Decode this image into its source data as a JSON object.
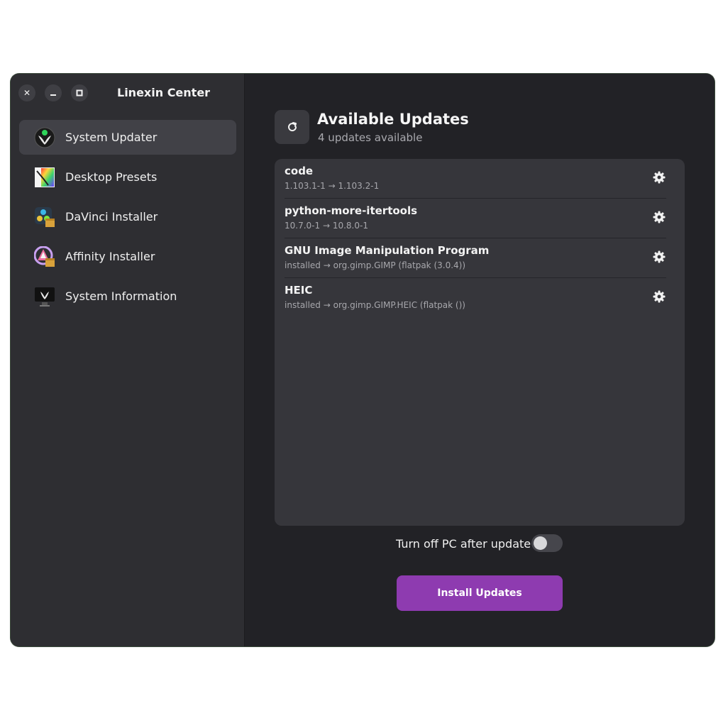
{
  "window": {
    "title": "Linexin Center",
    "controls": {
      "close": "✕",
      "minimize": "–",
      "maximize": "□"
    }
  },
  "sidebar": {
    "items": [
      {
        "label": "System Updater",
        "icon": "system-updater-icon",
        "active": true
      },
      {
        "label": "Desktop Presets",
        "icon": "desktop-presets-icon",
        "active": false
      },
      {
        "label": "DaVinci Installer",
        "icon": "davinci-installer-icon",
        "active": false
      },
      {
        "label": "Affinity Installer",
        "icon": "affinity-installer-icon",
        "active": false
      },
      {
        "label": "System Information",
        "icon": "system-information-icon",
        "active": false
      }
    ]
  },
  "main": {
    "title": "Available Updates",
    "subtitle": "4 updates available",
    "updates": [
      {
        "name": "code",
        "version": "1.103.1-1 → 1.103.2-1"
      },
      {
        "name": "python-more-itertools",
        "version": "10.7.0-1 → 10.8.0-1"
      },
      {
        "name": "GNU Image Manipulation Program",
        "version": "installed → org.gimp.GIMP (flatpak (3.0.4))"
      },
      {
        "name": "HEIC",
        "version": "installed → org.gimp.GIMP.HEIC (flatpak ())"
      }
    ],
    "shutdown_toggle_label": "Turn off PC after update",
    "shutdown_toggle_on": false,
    "install_button": "Install Updates"
  },
  "colors": {
    "accent": "#8e3bb0",
    "sidebar_bg": "#2e2e32",
    "main_bg": "#222226",
    "list_bg": "#36363b"
  }
}
